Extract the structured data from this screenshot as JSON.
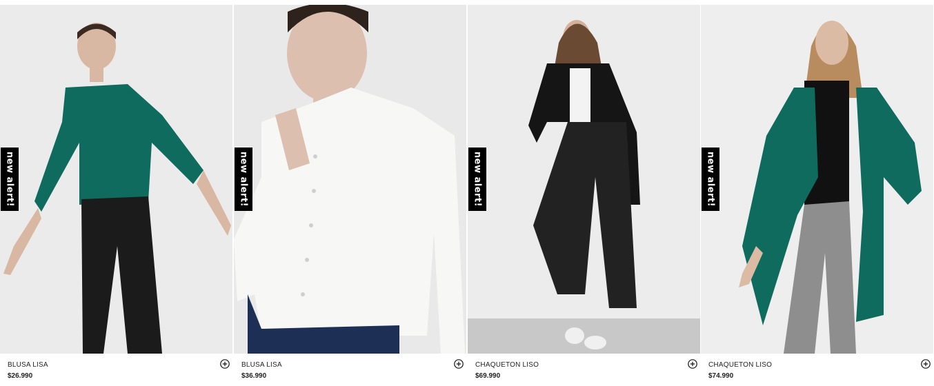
{
  "products": [
    {
      "badge": "new alert!",
      "name": "BLUSA LISA",
      "price": "$26.990",
      "bg": "#ebebeb",
      "garment": "#0e6b5e",
      "bottom": "#1b1b1b",
      "icon": "plus-circle-icon"
    },
    {
      "badge": "new alert!",
      "name": "BLUSA LISA",
      "price": "$36.990",
      "bg": "#e9e9e9",
      "garment": "#f7f7f5",
      "bottom": "#1e2f55",
      "icon": "plus-circle-icon"
    },
    {
      "badge": "new alert!",
      "name": "CHAQUETON LISO",
      "price": "$69.990",
      "bg": "#ececec",
      "garment": "#151515",
      "bottom": "#222222",
      "icon": "plus-circle-icon"
    },
    {
      "badge": "new alert!",
      "name": "CHAQUETON LISO",
      "price": "$74.990",
      "bg": "#eeeeee",
      "garment": "#0e6b5e",
      "bottom": "#8e8e8e",
      "icon": "plus-circle-icon"
    }
  ]
}
